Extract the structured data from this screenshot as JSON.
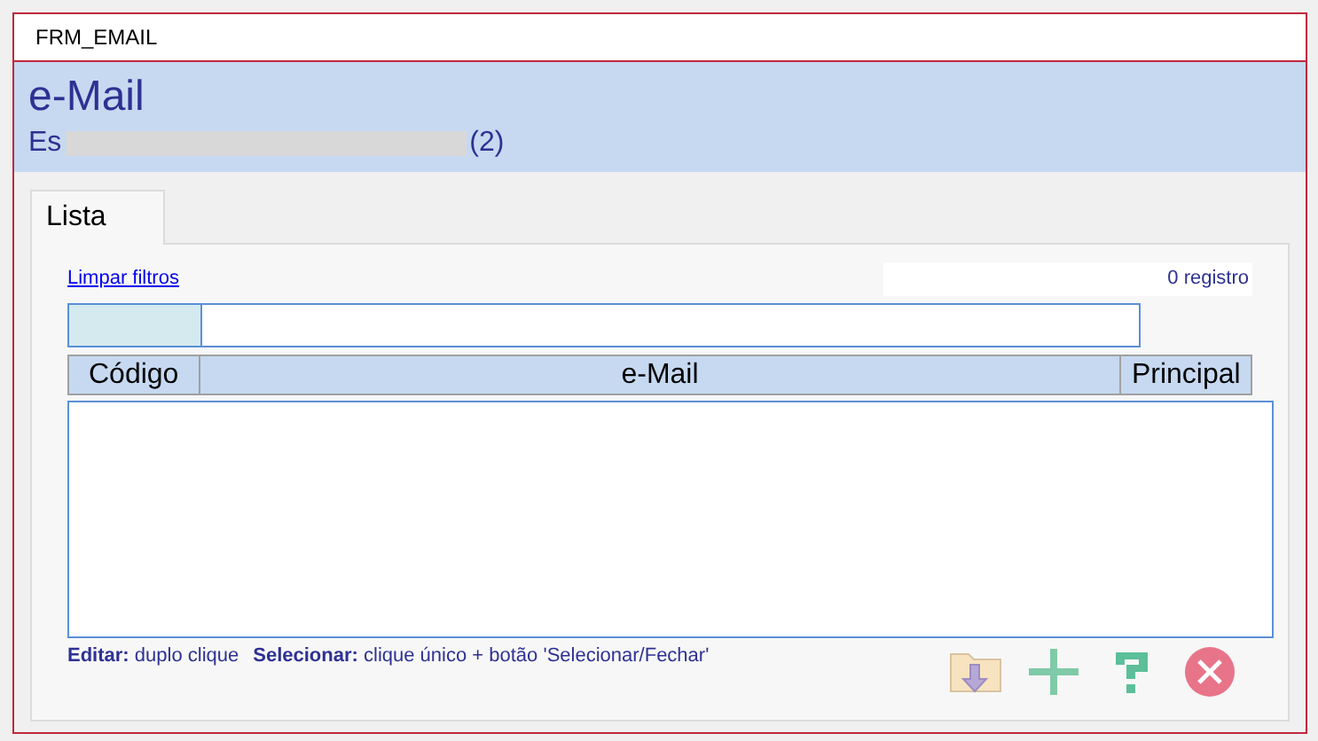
{
  "window": {
    "title": "FRM_EMAIL"
  },
  "header": {
    "title": "e-Mail",
    "subtitle_start": "Es",
    "subtitle_end": "(2)"
  },
  "tabs": [
    {
      "label": "Lista",
      "selected": true
    }
  ],
  "list": {
    "clear_filters": "Limpar filtros",
    "count": "0 registro",
    "columns": [
      "Código",
      "e-Mail",
      "Principal"
    ]
  },
  "hints": [
    {
      "label": "Editar:",
      "text": "duplo clique"
    },
    {
      "label": "Selecionar:",
      "text": "clique único + botão 'Selecionar/Fechar'"
    }
  ],
  "actions": [
    {
      "kind": "export"
    },
    {
      "kind": "add"
    },
    {
      "kind": "help"
    },
    {
      "kind": "close"
    }
  ]
}
